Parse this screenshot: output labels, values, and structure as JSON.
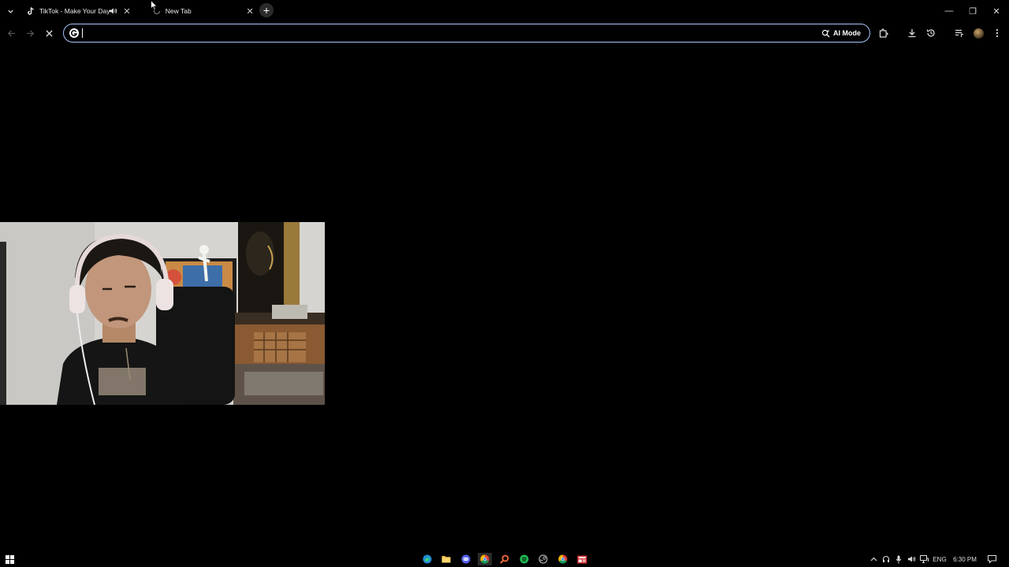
{
  "browser": {
    "tabs": [
      {
        "title": "TikTok - Make Your Day",
        "icon": "tiktok-icon",
        "audio": true
      },
      {
        "title": "New Tab",
        "icon": "loading-icon",
        "audio": false
      }
    ],
    "new_tab_symbol": "+",
    "window_controls": {
      "minimize": "—",
      "restore": "❐",
      "close": "✕"
    }
  },
  "toolbar": {
    "address_value": "",
    "ai_mode_label": "AI Mode"
  },
  "taskbar": {
    "apps": [
      "edge-icon",
      "file-explorer-icon",
      "discord-icon",
      "chrome-icon",
      "search-app-icon",
      "spotify-icon",
      "steam-icon",
      "chrome-icon",
      "news-icon"
    ],
    "language": "ENG",
    "time": "6:30 PM"
  }
}
